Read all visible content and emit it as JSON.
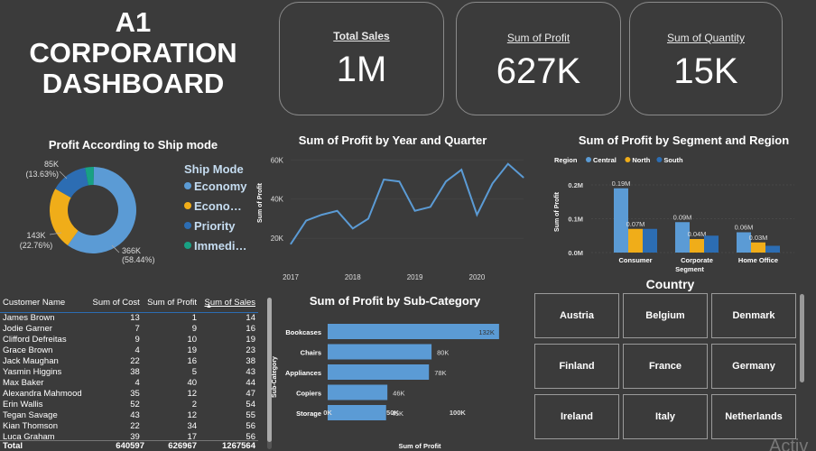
{
  "dashboard": {
    "title_line1": "A1",
    "title_line2": "CORPORATION",
    "title_line3": "DASHBOARD"
  },
  "kpis": [
    {
      "label": "Total Sales",
      "value": "1M"
    },
    {
      "label": "Sum of Profit",
      "value": "627K"
    },
    {
      "label": "Sum of Quantity",
      "value": "15K"
    }
  ],
  "donut": {
    "title": "Profit According to Ship mode",
    "legend_title": "Ship Mode",
    "slices": [
      {
        "name": "Economy",
        "legend": "Economy",
        "value": 366,
        "label1": "366K",
        "label2": "(58.44%)",
        "color": "#5b9bd5"
      },
      {
        "name": "Economy Plus",
        "legend": "Econo…",
        "value": 143,
        "label1": "143K",
        "label2": "(22.76%)",
        "color": "#f0ad19"
      },
      {
        "name": "Priority",
        "legend": "Priority",
        "value": 85,
        "label1": "85K",
        "label2": "(13.63%)",
        "color": "#2c6db3"
      },
      {
        "name": "Immediate",
        "legend": "Immedi…",
        "value": 20,
        "label1": "",
        "label2": "",
        "color": "#18a183"
      }
    ]
  },
  "table": {
    "headers": [
      "Customer Name",
      "Sum of Cost",
      "Sum of Profit",
      "Sum of Sales"
    ],
    "rows": [
      [
        "James Brown",
        "13",
        "1",
        "14"
      ],
      [
        "Jodie Garner",
        "7",
        "9",
        "16"
      ],
      [
        "Clifford Defreitas",
        "9",
        "10",
        "19"
      ],
      [
        "Grace Brown",
        "4",
        "19",
        "23"
      ],
      [
        "Jack Maughan",
        "22",
        "16",
        "38"
      ],
      [
        "Yasmin Higgins",
        "38",
        "5",
        "43"
      ],
      [
        "Max Baker",
        "4",
        "40",
        "44"
      ],
      [
        "Alexandra Mahmood",
        "35",
        "12",
        "47"
      ],
      [
        "Erin Wallis",
        "52",
        "2",
        "54"
      ],
      [
        "Tegan Savage",
        "43",
        "12",
        "55"
      ],
      [
        "Kian Thomson",
        "22",
        "34",
        "56"
      ],
      [
        "Luca Graham",
        "39",
        "17",
        "56"
      ]
    ],
    "total": [
      "Total",
      "640597",
      "626967",
      "1267564"
    ]
  },
  "country": {
    "title": "Country",
    "items": [
      "Austria",
      "Belgium",
      "Denmark",
      "Finland",
      "France",
      "Germany",
      "Ireland",
      "Italy",
      "Netherlands"
    ]
  },
  "watermark": "Activ",
  "chart_data": [
    {
      "type": "line",
      "title": "Sum of Profit by Year and Quarter",
      "xlabel": "Year",
      "ylabel": "Sum of Profit",
      "x_ticks": [
        "2017",
        "2018",
        "2019",
        "2020"
      ],
      "y_ticks": [
        "20K",
        "40K",
        "60K"
      ],
      "ylim": [
        15000,
        62000
      ],
      "color": "#5b9bd5",
      "x": [
        "2017 Q1",
        "2017 Q2",
        "2017 Q3",
        "2017 Q4",
        "2018 Q1",
        "2018 Q2",
        "2018 Q3",
        "2018 Q4",
        "2019 Q1",
        "2019 Q2",
        "2019 Q3",
        "2019 Q4",
        "2020 Q1",
        "2020 Q2",
        "2020 Q3",
        "2020 Q4"
      ],
      "values": [
        17000,
        29000,
        32000,
        34000,
        25000,
        30000,
        50000,
        49000,
        34000,
        36000,
        49000,
        55000,
        32000,
        48000,
        58000,
        51000
      ]
    },
    {
      "type": "bar",
      "title": "Sum of Profit by Segment and Region",
      "legend_title": "Region",
      "legend_position": "top-left",
      "xlabel": "Segment",
      "ylabel": "Sum of Profit",
      "y_ticks": [
        "0.0M",
        "0.1M",
        "0.2M"
      ],
      "ylim": [
        0,
        0.2
      ],
      "categories": [
        "Consumer",
        "Corporate",
        "Home Office"
      ],
      "series": [
        {
          "name": "Central",
          "color": "#5b9bd5",
          "values": [
            0.19,
            0.09,
            0.06
          ],
          "labels": [
            "0.19M",
            "0.09M",
            "0.06M"
          ]
        },
        {
          "name": "North",
          "color": "#f0ad19",
          "values": [
            0.07,
            0.04,
            0.03
          ],
          "labels": [
            "0.07M",
            "0.04M",
            "0.03M"
          ]
        },
        {
          "name": "South",
          "color": "#2c6db3",
          "values": [
            0.07,
            0.05,
            0.02
          ],
          "labels": [
            "",
            "",
            ""
          ]
        }
      ]
    },
    {
      "type": "bar",
      "orientation": "horizontal",
      "title": "Sum of Profit by Sub-Category",
      "xlabel": "Sum of Profit",
      "ylabel": "Sub-Category",
      "x_ticks": [
        "0K",
        "50K",
        "100K"
      ],
      "xlim": [
        0,
        130000
      ],
      "color": "#5b9bd5",
      "categories": [
        "Bookcases",
        "Chairs",
        "Appliances",
        "Copiers",
        "Storage"
      ],
      "values": [
        132000,
        80000,
        78000,
        46000,
        45000
      ],
      "labels": [
        "132K",
        "80K",
        "78K",
        "46K",
        "45K"
      ]
    }
  ]
}
